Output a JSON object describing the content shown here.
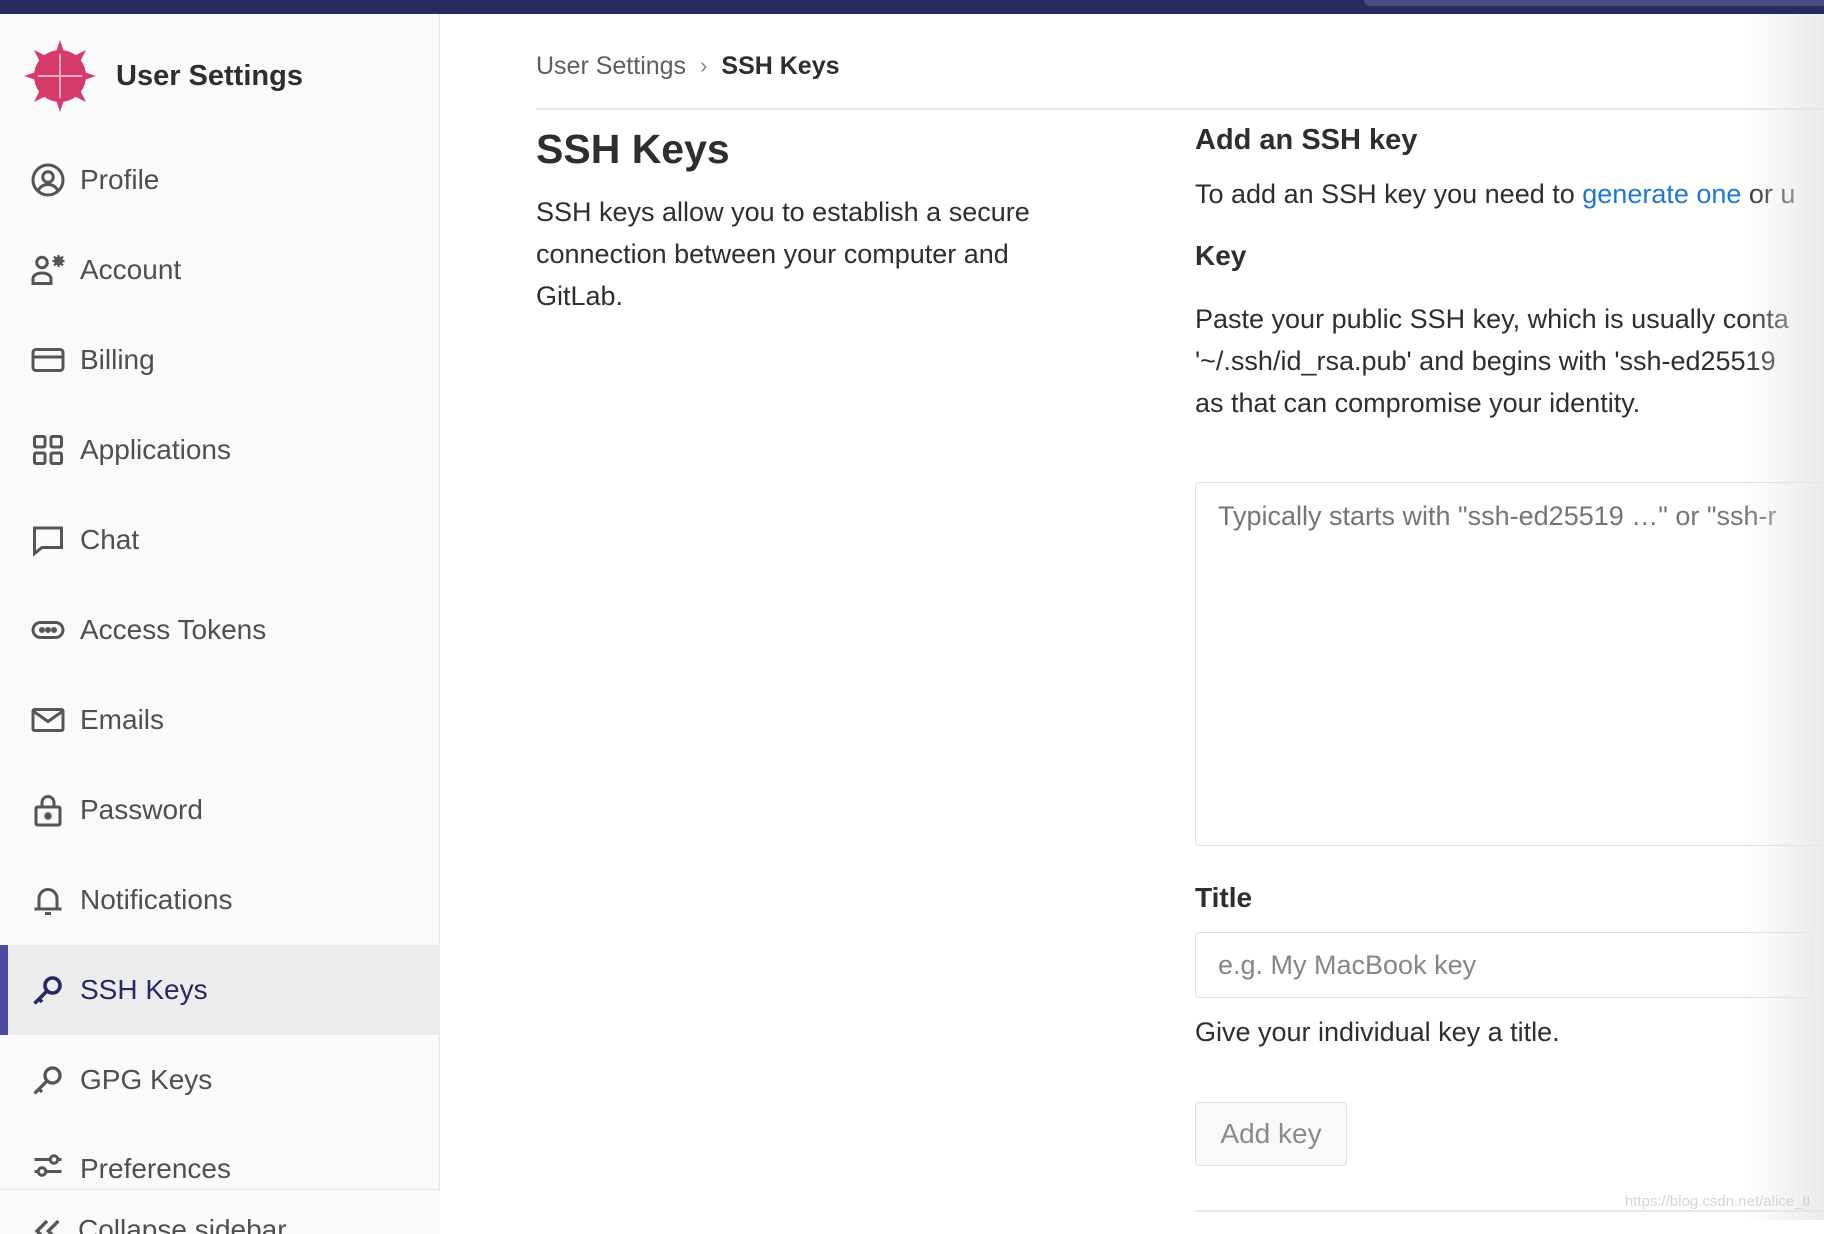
{
  "sidebar": {
    "title": "User Settings",
    "items": [
      {
        "label": "Profile",
        "icon": "profile-icon"
      },
      {
        "label": "Account",
        "icon": "account-icon"
      },
      {
        "label": "Billing",
        "icon": "billing-icon"
      },
      {
        "label": "Applications",
        "icon": "applications-icon"
      },
      {
        "label": "Chat",
        "icon": "chat-icon"
      },
      {
        "label": "Access Tokens",
        "icon": "access-tokens-icon"
      },
      {
        "label": "Emails",
        "icon": "emails-icon"
      },
      {
        "label": "Password",
        "icon": "lock-icon"
      },
      {
        "label": "Notifications",
        "icon": "bell-icon"
      },
      {
        "label": "SSH Keys",
        "icon": "key-icon",
        "active": true
      },
      {
        "label": "GPG Keys",
        "icon": "key-icon"
      },
      {
        "label": "Preferences",
        "icon": "preferences-icon"
      }
    ],
    "collapse_label": "Collapse sidebar"
  },
  "breadcrumb": {
    "parent": "User Settings",
    "separator": "›",
    "current": "SSH Keys"
  },
  "intro": {
    "heading": "SSH Keys",
    "description": "SSH keys allow you to establish a secure connection between your computer and GitLab."
  },
  "form": {
    "heading": "Add an SSH key",
    "intro_prefix": "To add an SSH key you need to ",
    "intro_link": "generate one",
    "intro_suffix": " or u",
    "key_label": "Key",
    "key_help_lines": [
      "Paste your public SSH key, which is usually conta",
      "'~/.ssh/id_rsa.pub' and begins with 'ssh-ed25519",
      "as that can compromise your identity."
    ],
    "key_placeholder": "Typically starts with \"ssh-ed25519 …\" or \"ssh-r",
    "title_label": "Title",
    "title_placeholder": "e.g. My MacBook key",
    "title_help": "Give your individual key a title.",
    "submit_label": "Add key"
  },
  "watermark": "https://blog.csdn.net/alice_tl",
  "colors": {
    "topbar": "#292961",
    "active_accent": "#4b4ba3",
    "link": "#1f78d1",
    "logo": "#d63a6b"
  }
}
